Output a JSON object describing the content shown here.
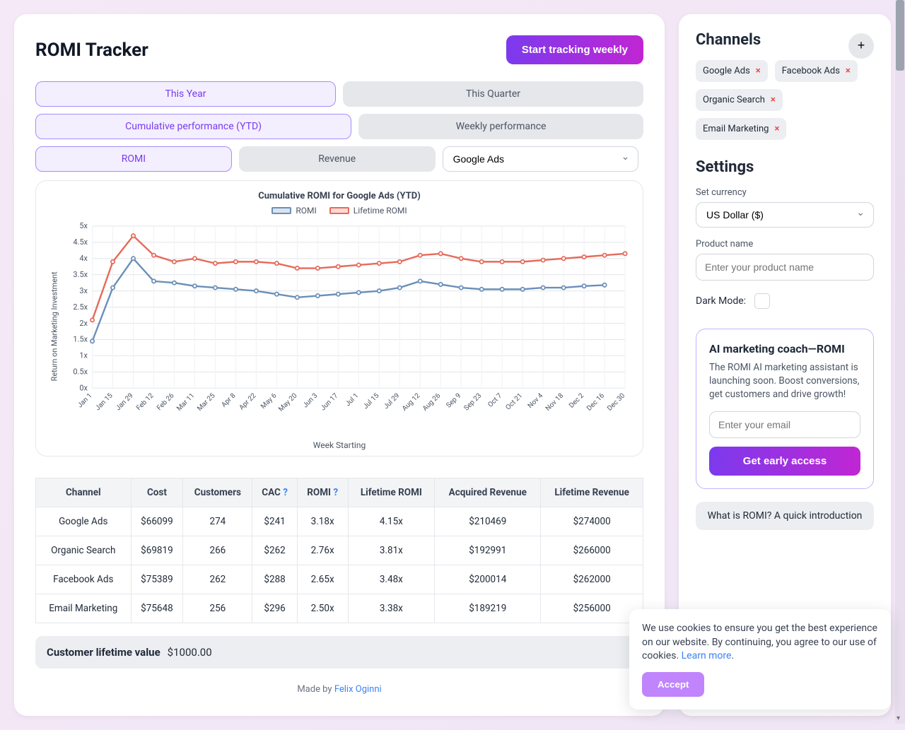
{
  "header": {
    "title": "ROMI Tracker",
    "cta": "Start tracking weekly"
  },
  "segs": {
    "period": {
      "a": "This Year",
      "b": "This Quarter"
    },
    "perf": {
      "a": "Cumulative performance (YTD)",
      "b": "Weekly performance"
    },
    "metric": {
      "a": "ROMI",
      "b": "Revenue"
    },
    "channel": "Google Ads"
  },
  "chart": {
    "title": "Cumulative ROMI for Google Ads (YTD)",
    "legend": {
      "a": "ROMI",
      "b": "Lifetime ROMI"
    },
    "ylabel": "Return on Marketing Investment",
    "xlabel": "Week Starting"
  },
  "table": {
    "headers": {
      "c0": "Channel",
      "c1": "Cost",
      "c2": "Customers",
      "c3": "CAC",
      "c4": "ROMI",
      "c5": "Lifetime ROMI",
      "c6": "Acquired Revenue",
      "c7": "Lifetime Revenue"
    },
    "rows": [
      {
        "c0": "Google Ads",
        "c1": "$66099",
        "c2": "274",
        "c3": "$241",
        "c4": "3.18x",
        "c5": "4.15x",
        "c6": "$210469",
        "c7": "$274000"
      },
      {
        "c0": "Organic Search",
        "c1": "$69819",
        "c2": "266",
        "c3": "$262",
        "c4": "2.76x",
        "c5": "3.81x",
        "c6": "$192991",
        "c7": "$266000"
      },
      {
        "c0": "Facebook Ads",
        "c1": "$75389",
        "c2": "262",
        "c3": "$288",
        "c4": "2.65x",
        "c5": "3.48x",
        "c6": "$200014",
        "c7": "$262000"
      },
      {
        "c0": "Email Marketing",
        "c1": "$75648",
        "c2": "256",
        "c3": "$296",
        "c4": "2.50x",
        "c5": "3.38x",
        "c6": "$189219",
        "c7": "$256000"
      }
    ]
  },
  "clv": {
    "label": "Customer lifetime value",
    "value": "$1000.00"
  },
  "footer": {
    "made": "Made by",
    "author": "Felix Oginni"
  },
  "side": {
    "channels_title": "Channels",
    "chips": [
      "Google Ads",
      "Facebook Ads",
      "Organic Search",
      "Email Marketing"
    ],
    "settings_title": "Settings",
    "currency_label": "Set currency",
    "currency_value": "US Dollar ($)",
    "product_label": "Product name",
    "product_placeholder": "Enter your product name",
    "dark_label": "Dark Mode:",
    "coach": {
      "title": "AI marketing coach—ROMI",
      "desc": "The ROMI AI marketing assistant is launching soon. Boost conversions, get customers and drive growth!",
      "email_placeholder": "Enter your email",
      "cta": "Get early access"
    },
    "what_is": "What is ROMI? A quick introduction"
  },
  "cookie": {
    "text": "We use cookies to ensure you get the best experience on our website. By continuing, you agree to our use of cookies.",
    "learn": "Learn more",
    "accept": "Accept"
  },
  "chart_data": {
    "type": "line",
    "xlabel": "Week Starting",
    "ylabel": "Return on Marketing Investment",
    "ylim": [
      0,
      5
    ],
    "ytick_labels": [
      "0x",
      "0.5x",
      "1x",
      "1.5x",
      "2x",
      "2.5x",
      "3x",
      "3.5x",
      "4x",
      "4.5x",
      "5x"
    ],
    "categories": [
      "Jan 1",
      "Jan 15",
      "Jan 29",
      "Feb 12",
      "Feb 26",
      "Mar 11",
      "Mar 25",
      "Apr 8",
      "Apr 22",
      "May 6",
      "May 20",
      "Jun 3",
      "Jun 17",
      "Jul 1",
      "Jul 15",
      "Jul 29",
      "Aug 12",
      "Aug 26",
      "Sep 9",
      "Sep 23",
      "Oct 7",
      "Oct 21",
      "Nov 4",
      "Nov 18",
      "Dec 2",
      "Dec 16",
      "Dec 30"
    ],
    "series": [
      {
        "name": "ROMI",
        "color": "#6b8fb8",
        "values": [
          1.45,
          3.1,
          4.0,
          3.3,
          3.25,
          3.15,
          3.1,
          3.05,
          3.0,
          2.9,
          2.8,
          2.85,
          2.9,
          2.95,
          3.0,
          3.1,
          3.3,
          3.2,
          3.1,
          3.05,
          3.05,
          3.05,
          3.1,
          3.1,
          3.15,
          3.18
        ]
      },
      {
        "name": "Lifetime ROMI",
        "color": "#e66a5a",
        "values": [
          2.1,
          3.9,
          4.7,
          4.1,
          3.9,
          4.0,
          3.85,
          3.9,
          3.9,
          3.85,
          3.7,
          3.7,
          3.75,
          3.8,
          3.85,
          3.9,
          4.1,
          4.15,
          4.0,
          3.9,
          3.9,
          3.9,
          3.95,
          4.0,
          4.05,
          4.1,
          4.15
        ]
      }
    ]
  }
}
